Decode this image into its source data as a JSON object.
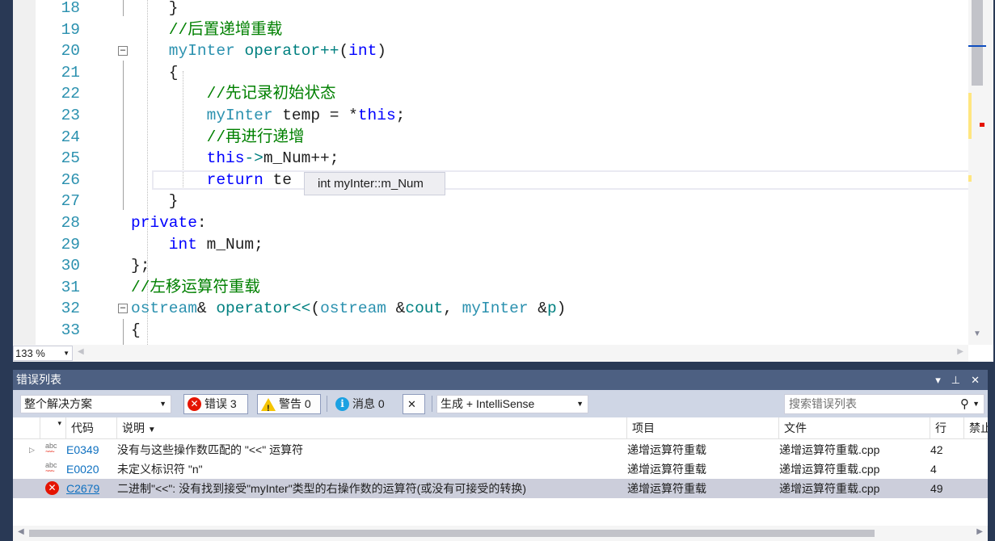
{
  "editor": {
    "lines": [
      {
        "n": "18",
        "parts": [
          [
            "",
            "    }"
          ]
        ]
      },
      {
        "n": "19",
        "parts": [
          [
            "cm",
            "    //后置递增重载"
          ]
        ]
      },
      {
        "n": "20",
        "parts": [
          [
            "ty",
            "    myInter"
          ],
          [
            "",
            " "
          ],
          [
            "op",
            "operator++"
          ],
          [
            "",
            "("
          ],
          [
            "kw",
            "int"
          ],
          [
            "",
            ")"
          ]
        ]
      },
      {
        "n": "21",
        "parts": [
          [
            "",
            "    {"
          ]
        ]
      },
      {
        "n": "22",
        "parts": [
          [
            "cm",
            "        //先记录初始状态"
          ]
        ]
      },
      {
        "n": "23",
        "parts": [
          [
            "ty",
            "        myInter"
          ],
          [
            "",
            " temp = *"
          ],
          [
            "kw",
            "this"
          ],
          [
            "",
            ";"
          ]
        ]
      },
      {
        "n": "24",
        "parts": [
          [
            "cm",
            "        //再进行递增"
          ]
        ]
      },
      {
        "n": "25",
        "parts": [
          [
            "kw",
            "        this"
          ],
          [
            "op",
            "->"
          ],
          [
            "",
            "m_Num++;"
          ]
        ]
      },
      {
        "n": "26",
        "parts": [
          [
            "kw",
            "        return"
          ],
          [
            "",
            " te"
          ]
        ]
      },
      {
        "n": "27",
        "parts": [
          [
            "",
            "    }"
          ]
        ]
      },
      {
        "n": "28",
        "parts": [
          [
            "kw",
            "private"
          ],
          [
            "",
            ":"
          ]
        ]
      },
      {
        "n": "29",
        "parts": [
          [
            "kw",
            "    int"
          ],
          [
            "",
            " m_Num;"
          ]
        ]
      },
      {
        "n": "30",
        "parts": [
          [
            "",
            "};"
          ]
        ]
      },
      {
        "n": "31",
        "parts": [
          [
            "cm",
            "//左移运算符重载"
          ]
        ]
      },
      {
        "n": "32",
        "parts": [
          [
            "ty",
            "ostream"
          ],
          [
            "",
            "& "
          ],
          [
            "op",
            "operator<<"
          ],
          [
            "",
            "("
          ],
          [
            "ty",
            "ostream"
          ],
          [
            "",
            " &"
          ],
          [
            "op",
            "cout"
          ],
          [
            "",
            ", "
          ],
          [
            "ty",
            "myInter"
          ],
          [
            "",
            " &"
          ],
          [
            "op",
            "p"
          ],
          [
            "",
            ")"
          ]
        ]
      },
      {
        "n": "33",
        "parts": [
          [
            "",
            "{"
          ]
        ]
      }
    ],
    "tooltip": "int myInter::m_Num",
    "zoom": "133 %"
  },
  "error_list": {
    "title": "错误列表",
    "scope_filter": "整个解决方案",
    "errors_label": "错误 3",
    "warnings_label": "警告 0",
    "messages_label": "消息 0",
    "build_filter": "生成 + IntelliSense",
    "search_placeholder": "搜索错误列表",
    "columns": {
      "code": "代码",
      "description": "说明",
      "project": "项目",
      "file": "文件",
      "line": "行",
      "suppress": "禁止"
    },
    "rows": [
      {
        "code": "E0349",
        "description": "没有与这些操作数匹配的 \"<<\" 运算符",
        "project": "递增运算符重载",
        "file": "递增运算符重载.cpp",
        "line": "42"
      },
      {
        "code": "E0020",
        "description": "未定义标识符 \"n\"",
        "project": "递增运算符重载",
        "file": "递增运算符重载.cpp",
        "line": "4"
      },
      {
        "code": "C2679",
        "description": "二进制\"<<\": 没有找到接受\"myInter\"类型的右操作数的运算符(或没有可接受的转换)",
        "project": "递增运算符重载",
        "file": "递增运算符重载.cpp",
        "line": "49"
      }
    ]
  }
}
